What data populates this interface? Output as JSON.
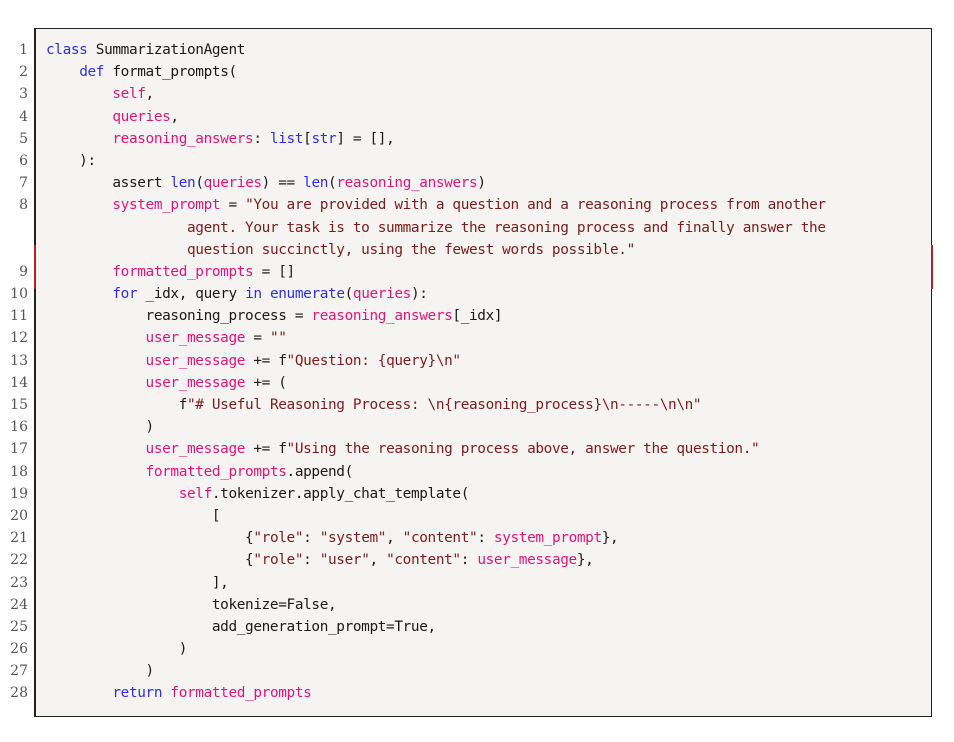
{
  "colors": {
    "keyword": "#2f2fe0",
    "variable": "#e0157a",
    "string": "#7a1c1c",
    "default": "#1a1a1a"
  },
  "lines": [
    {
      "number": "1",
      "rows": [
        [
          [
            "k",
            "class"
          ],
          [
            "n",
            " SummarizationAgent"
          ]
        ]
      ]
    },
    {
      "number": "2",
      "rows": [
        [
          [
            "n",
            "    "
          ],
          [
            "k",
            "def"
          ],
          [
            "n",
            " format_prompts("
          ]
        ]
      ]
    },
    {
      "number": "3",
      "rows": [
        [
          [
            "n",
            "        "
          ],
          [
            "v",
            "self"
          ],
          [
            "n",
            ","
          ]
        ]
      ]
    },
    {
      "number": "4",
      "rows": [
        [
          [
            "n",
            "        "
          ],
          [
            "v",
            "queries"
          ],
          [
            "n",
            ","
          ]
        ]
      ]
    },
    {
      "number": "5",
      "rows": [
        [
          [
            "n",
            "        "
          ],
          [
            "v",
            "reasoning_answers"
          ],
          [
            "n",
            ": "
          ],
          [
            "k",
            "list"
          ],
          [
            "n",
            "["
          ],
          [
            "k",
            "str"
          ],
          [
            "n",
            "] = [],"
          ]
        ]
      ]
    },
    {
      "number": "6",
      "rows": [
        [
          [
            "n",
            "    ):"
          ]
        ]
      ]
    },
    {
      "number": "7",
      "rows": [
        [
          [
            "n",
            "        assert "
          ],
          [
            "k",
            "len"
          ],
          [
            "n",
            "("
          ],
          [
            "v",
            "queries"
          ],
          [
            "n",
            ") == "
          ],
          [
            "k",
            "len"
          ],
          [
            "n",
            "("
          ],
          [
            "v",
            "reasoning_answers"
          ],
          [
            "n",
            ")"
          ]
        ]
      ]
    },
    {
      "number": "8",
      "rows": [
        [
          [
            "n",
            "        "
          ],
          [
            "v",
            "system_prompt"
          ],
          [
            "n",
            " = "
          ],
          [
            "s",
            "\"You are provided with a question and a reasoning process from another"
          ]
        ],
        [
          [
            "n",
            "                 "
          ],
          [
            "s",
            "agent. Your task is to summarize the reasoning process and finally answer the"
          ]
        ],
        [
          [
            "n",
            "                 "
          ],
          [
            "s",
            "question succinctly, using the fewest words possible.\""
          ]
        ]
      ]
    },
    {
      "number": "9",
      "rows": [
        [
          [
            "n",
            "        "
          ],
          [
            "v",
            "formatted_prompts"
          ],
          [
            "n",
            " = []"
          ]
        ]
      ]
    },
    {
      "number": "10",
      "rows": [
        [
          [
            "n",
            "        "
          ],
          [
            "k",
            "for"
          ],
          [
            "n",
            " _idx, query "
          ],
          [
            "k",
            "in"
          ],
          [
            "n",
            " "
          ],
          [
            "k",
            "enumerate"
          ],
          [
            "n",
            "("
          ],
          [
            "v",
            "queries"
          ],
          [
            "n",
            "):"
          ]
        ]
      ]
    },
    {
      "number": "11",
      "rows": [
        [
          [
            "n",
            "            reasoning_process = "
          ],
          [
            "v",
            "reasoning_answers"
          ],
          [
            "n",
            "[_idx]"
          ]
        ]
      ]
    },
    {
      "number": "12",
      "rows": [
        [
          [
            "n",
            "            "
          ],
          [
            "v",
            "user_message"
          ],
          [
            "n",
            " = "
          ],
          [
            "s",
            "\"\""
          ]
        ]
      ]
    },
    {
      "number": "13",
      "rows": [
        [
          [
            "n",
            "            "
          ],
          [
            "v",
            "user_message"
          ],
          [
            "n",
            " += f"
          ],
          [
            "s",
            "\"Question: {query}\\n\""
          ]
        ]
      ]
    },
    {
      "number": "14",
      "rows": [
        [
          [
            "n",
            "            "
          ],
          [
            "v",
            "user_message"
          ],
          [
            "n",
            " += ("
          ]
        ]
      ]
    },
    {
      "number": "15",
      "rows": [
        [
          [
            "n",
            "                f"
          ],
          [
            "s",
            "\"# Useful Reasoning Process: \\n{reasoning_process}\\n-----\\n\\n\""
          ]
        ]
      ]
    },
    {
      "number": "16",
      "rows": [
        [
          [
            "n",
            "            )"
          ]
        ]
      ]
    },
    {
      "number": "17",
      "rows": [
        [
          [
            "n",
            "            "
          ],
          [
            "v",
            "user_message"
          ],
          [
            "n",
            " += f"
          ],
          [
            "s",
            "\"Using the reasoning process above, answer the question.\""
          ]
        ]
      ]
    },
    {
      "number": "18",
      "rows": [
        [
          [
            "n",
            "            "
          ],
          [
            "v",
            "formatted_prompts"
          ],
          [
            "n",
            ".append("
          ]
        ]
      ]
    },
    {
      "number": "19",
      "rows": [
        [
          [
            "n",
            "                "
          ],
          [
            "v",
            "self"
          ],
          [
            "n",
            ".tokenizer.apply_chat_template("
          ]
        ]
      ]
    },
    {
      "number": "20",
      "rows": [
        [
          [
            "n",
            "                    ["
          ]
        ]
      ]
    },
    {
      "number": "21",
      "rows": [
        [
          [
            "n",
            "                        {"
          ],
          [
            "s",
            "\"role\""
          ],
          [
            "n",
            ": "
          ],
          [
            "s",
            "\"system\""
          ],
          [
            "n",
            ", "
          ],
          [
            "s",
            "\"content\""
          ],
          [
            "n",
            ": "
          ],
          [
            "v",
            "system_prompt"
          ],
          [
            "n",
            "},"
          ]
        ]
      ]
    },
    {
      "number": "22",
      "rows": [
        [
          [
            "n",
            "                        {"
          ],
          [
            "s",
            "\"role\""
          ],
          [
            "n",
            ": "
          ],
          [
            "s",
            "\"user\""
          ],
          [
            "n",
            ", "
          ],
          [
            "s",
            "\"content\""
          ],
          [
            "n",
            ": "
          ],
          [
            "v",
            "user_message"
          ],
          [
            "n",
            "},"
          ]
        ]
      ]
    },
    {
      "number": "23",
      "rows": [
        [
          [
            "n",
            "                    ],"
          ]
        ]
      ]
    },
    {
      "number": "24",
      "rows": [
        [
          [
            "n",
            "                    tokenize=False,"
          ]
        ]
      ]
    },
    {
      "number": "25",
      "rows": [
        [
          [
            "n",
            "                    add_generation_prompt=True,"
          ]
        ]
      ]
    },
    {
      "number": "26",
      "rows": [
        [
          [
            "n",
            "                )"
          ]
        ]
      ]
    },
    {
      "number": "27",
      "rows": [
        [
          [
            "n",
            "            )"
          ]
        ]
      ]
    },
    {
      "number": "28",
      "rows": [
        [
          [
            "n",
            "        "
          ],
          [
            "k",
            "return"
          ],
          [
            "n",
            " "
          ],
          [
            "v",
            "formatted_prompts"
          ]
        ]
      ]
    }
  ]
}
